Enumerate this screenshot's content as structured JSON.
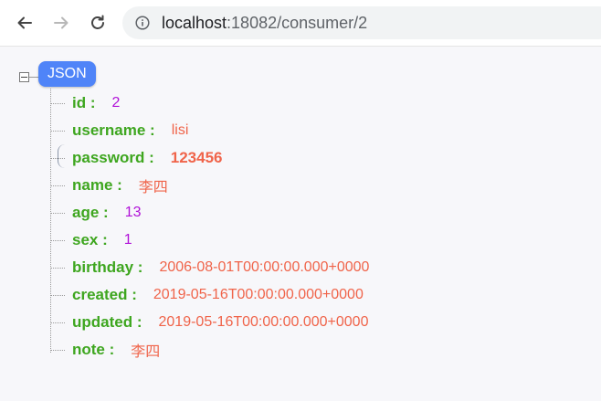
{
  "browser": {
    "url_host": "localhost",
    "url_rest": ":18082/consumer/2",
    "icons": {
      "back": "arrow-left-icon",
      "forward": "arrow-right-icon",
      "reload": "reload-icon",
      "info": "info-icon"
    }
  },
  "viewer": {
    "root_label": "JSON",
    "fields": [
      {
        "key": "id :",
        "value": "2",
        "type": "number"
      },
      {
        "key": "username :",
        "value": "lisi",
        "type": "string"
      },
      {
        "key": "password :",
        "value": "123456",
        "type": "string-highlight"
      },
      {
        "key": "name :",
        "value": "李四",
        "type": "string"
      },
      {
        "key": "age :",
        "value": "13",
        "type": "number"
      },
      {
        "key": "sex :",
        "value": "1",
        "type": "number"
      },
      {
        "key": "birthday :",
        "value": "2006-08-01T00:00:00.000+0000",
        "type": "string"
      },
      {
        "key": "created :",
        "value": "2019-05-16T00:00:00.000+0000",
        "type": "string"
      },
      {
        "key": "updated :",
        "value": "2019-05-16T00:00:00.000+0000",
        "type": "string"
      },
      {
        "key": "note :",
        "value": "李四",
        "type": "string"
      }
    ]
  },
  "colors": {
    "key": "#3ea61f",
    "number": "#b010d8",
    "string": "#f0644a",
    "badge": "#4f84f8"
  }
}
